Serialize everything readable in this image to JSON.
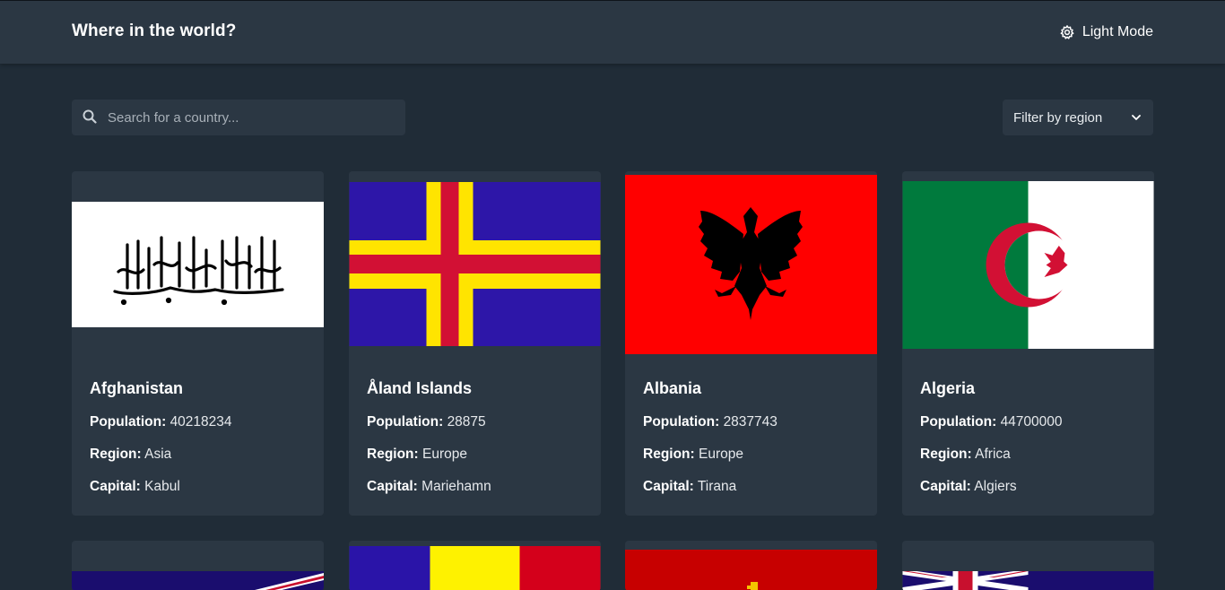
{
  "header": {
    "title": "Where in the world?",
    "mode_label": "Light Mode"
  },
  "search": {
    "placeholder": "Search for a country..."
  },
  "filter": {
    "label": "Filter by region"
  },
  "labels": {
    "population": "Population:",
    "region": "Region:",
    "capital": "Capital:"
  },
  "countries": [
    {
      "name": "Afghanistan",
      "population": "40218234",
      "region": "Asia",
      "capital": "Kabul"
    },
    {
      "name": "Åland Islands",
      "population": "28875",
      "region": "Europe",
      "capital": "Mariehamn"
    },
    {
      "name": "Albania",
      "population": "2837743",
      "region": "Europe",
      "capital": "Tirana"
    },
    {
      "name": "Algeria",
      "population": "44700000",
      "region": "Africa",
      "capital": "Algiers"
    }
  ],
  "colors": {
    "background": "#202c37",
    "element": "#2b3743",
    "text": "#ffffff"
  }
}
